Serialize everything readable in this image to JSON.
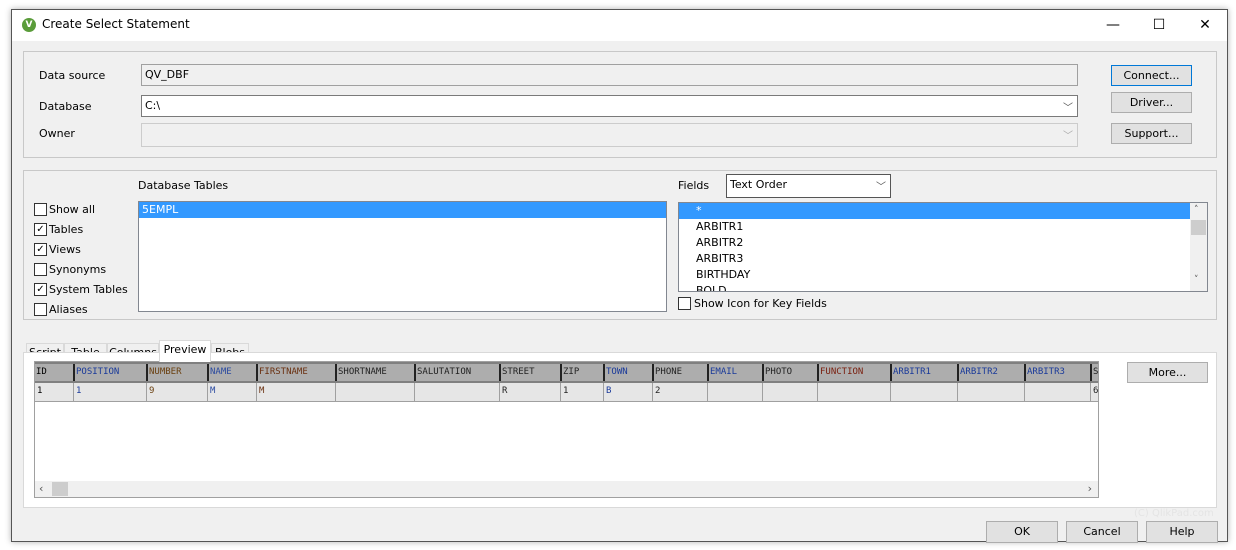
{
  "window": {
    "title": "Create Select Statement",
    "logo": "V",
    "minimize": "—",
    "maximize": "☐",
    "close": "✕"
  },
  "connection": {
    "data_source_label": "Data source",
    "data_source_value": "QV_DBF",
    "database_label": "Database",
    "database_value": "C:\\",
    "owner_label": "Owner",
    "owner_value": "",
    "connect_button": "Connect...",
    "driver_button": "Driver...",
    "support_button": "Support..."
  },
  "filters": [
    {
      "label": "Show all",
      "checked": false
    },
    {
      "label": "Tables",
      "checked": true
    },
    {
      "label": "Views",
      "checked": true
    },
    {
      "label": "Synonyms",
      "checked": false
    },
    {
      "label": "System Tables",
      "checked": true
    },
    {
      "label": "Aliases",
      "checked": false
    }
  ],
  "database_tables": {
    "label": "Database Tables",
    "items": [
      "5EMPL"
    ],
    "selected": "5EMPL"
  },
  "fields": {
    "label": "Fields",
    "order_value": "Text Order",
    "items": [
      "*",
      "ARBITR1",
      "ARBITR2",
      "ARBITR3",
      "BIRTHDAY",
      "BOLD"
    ],
    "show_icon_label": "Show Icon for Key Fields",
    "show_icon_checked": false
  },
  "tabs": [
    "Script",
    "Table",
    "Columns",
    "Preview",
    "Blobs"
  ],
  "active_tab": "Preview",
  "preview": {
    "columns": [
      "ID",
      "POSITION",
      "NUMBER",
      "NAME",
      "FIRSTNAME",
      "SHORTNAME",
      "SALUTATION",
      "STREET",
      "ZIP",
      "TOWN",
      "PHONE",
      "EMAIL",
      "PHOTO",
      "FUNCTION",
      "ARBITR1",
      "ARBITR2",
      "ARBITR3",
      "S"
    ],
    "rows": [
      [
        "1",
        "1",
        "9",
        "M",
        "M",
        "",
        "",
        "R",
        "1",
        "B",
        "2",
        "",
        "",
        "",
        "",
        "",
        "",
        "6"
      ]
    ],
    "more_button": "More..."
  },
  "watermark": "(C) QlikPad.com",
  "footer": {
    "ok": "OK",
    "cancel": "Cancel",
    "help": "Help"
  }
}
